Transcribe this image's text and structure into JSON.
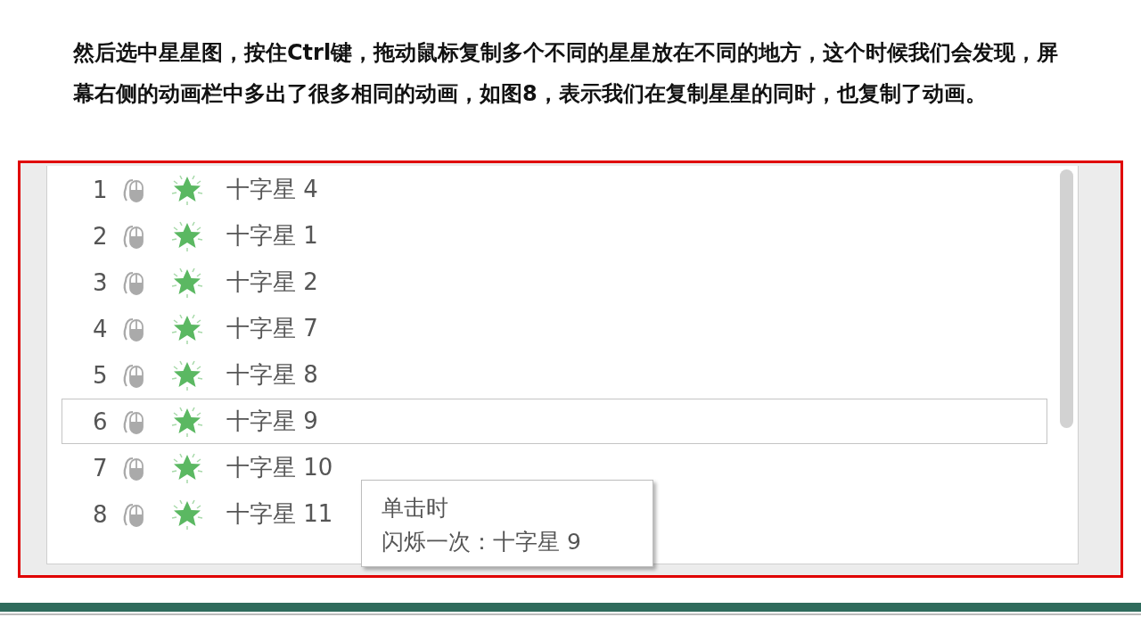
{
  "paragraph": "然后选中星星图，按住Ctrl键，拖动鼠标复制多个不同的星星放在不同的地方，这个时候我们会发现，屏幕右侧的动画栏中多出了很多相同的动画，如图8，表示我们在复制星星的同时，也复制了动画。",
  "animation_pane": {
    "rows": [
      {
        "number": "1",
        "name": "十字星 4",
        "selected": false
      },
      {
        "number": "2",
        "name": "十字星 1",
        "selected": false
      },
      {
        "number": "3",
        "name": "十字星 2",
        "selected": false
      },
      {
        "number": "4",
        "name": "十字星 7",
        "selected": false
      },
      {
        "number": "5",
        "name": "十字星 8",
        "selected": false
      },
      {
        "number": "6",
        "name": "十字星 9",
        "selected": true
      },
      {
        "number": "7",
        "name": "十字星 10",
        "selected": false
      },
      {
        "number": "8",
        "name": "十字星 11",
        "selected": false
      }
    ],
    "tooltip": {
      "trigger": "单击时",
      "effect": "闪烁一次：十字星 9"
    }
  }
}
